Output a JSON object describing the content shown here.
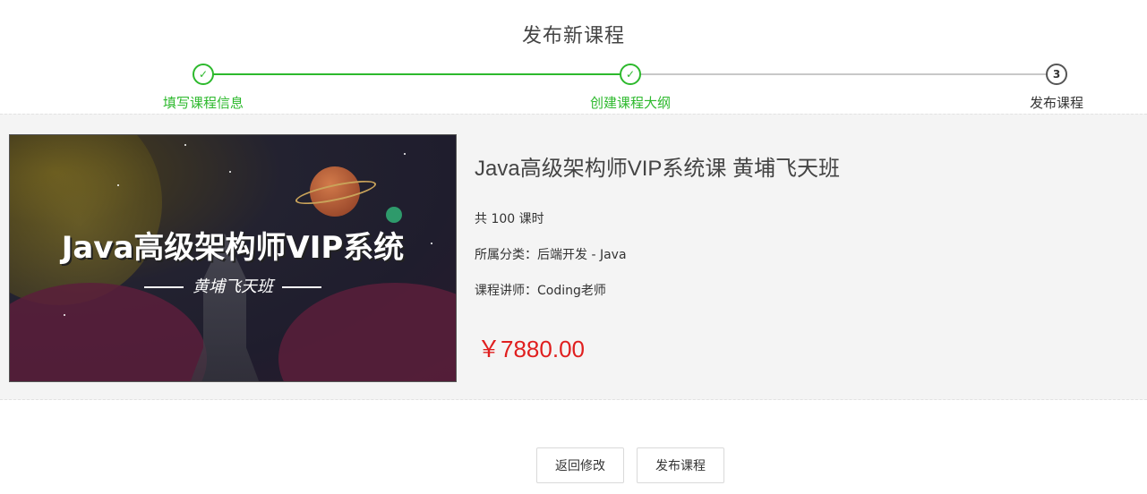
{
  "page": {
    "title": "发布新课程"
  },
  "steps": [
    {
      "label": "填写课程信息",
      "status": "done",
      "marker": "✓"
    },
    {
      "label": "创建课程大纲",
      "status": "done",
      "marker": "✓"
    },
    {
      "label": "发布课程",
      "status": "current",
      "marker": "3"
    }
  ],
  "course": {
    "cover_title": "Java高级架构师VIP系统",
    "cover_subtitle": "黄埔飞天班",
    "name": "Java高级架构师VIP系统课 黄埔飞天班",
    "lessons": "共 100 课时",
    "category_label": "所属分类：",
    "category_value": "后端开发 - Java",
    "teacher_label": "课程讲师：",
    "teacher_value": "Coding老师",
    "price": "￥7880.00"
  },
  "actions": {
    "back_label": "返回修改",
    "publish_label": "发布课程"
  },
  "colors": {
    "accent_green": "#2db92d",
    "price_red": "#e01f1f",
    "card_bg": "#f4f4f4"
  }
}
